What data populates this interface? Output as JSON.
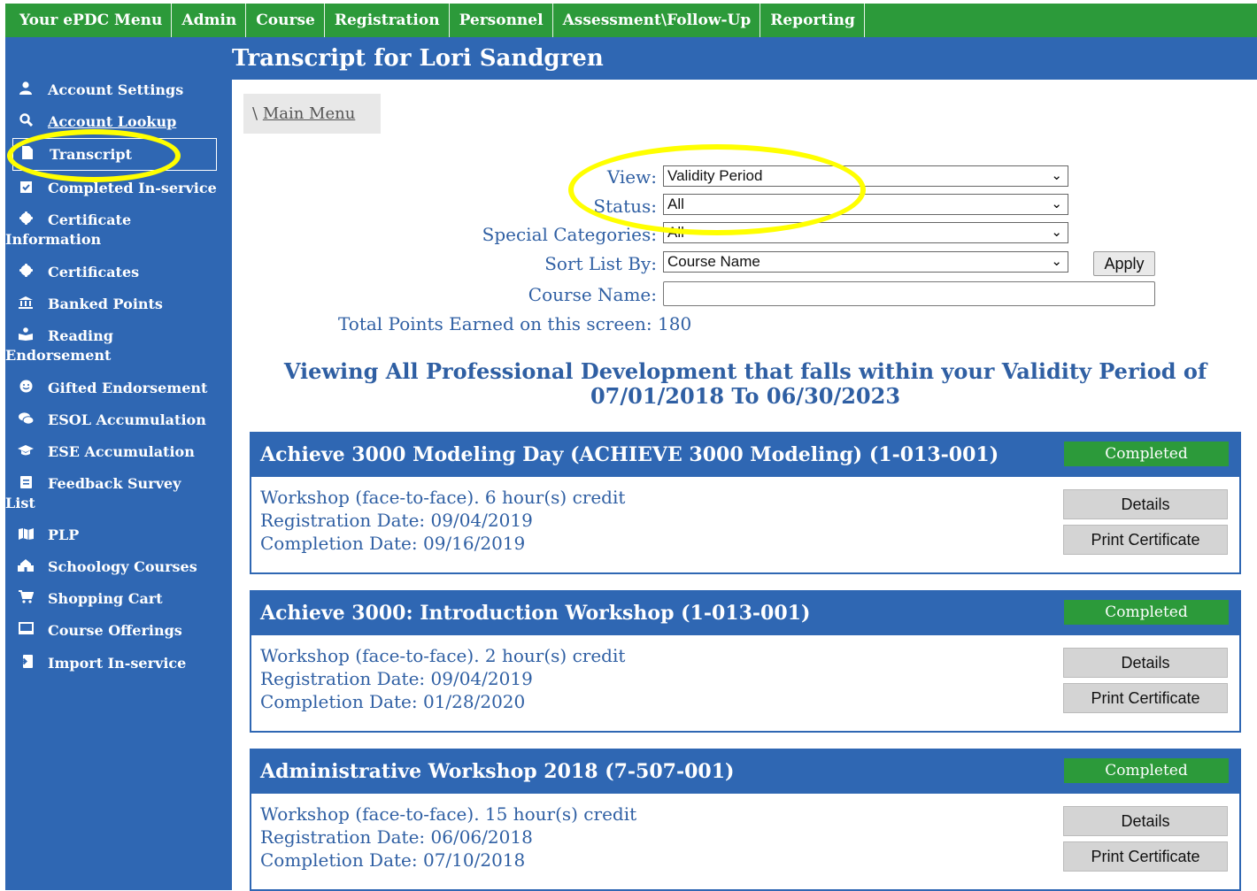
{
  "topnav": {
    "items": [
      "Your ePDC Menu",
      "Admin",
      "Course",
      "Registration",
      "Personnel",
      "Assessment\\Follow-Up",
      "Reporting"
    ]
  },
  "page": {
    "title": "Transcript for Lori Sandgren"
  },
  "sidebar": {
    "items": [
      {
        "label": "Account Settings",
        "icon": "user-icon"
      },
      {
        "label": "Account Lookup",
        "icon": "search-icon"
      },
      {
        "label": "Transcript",
        "icon": "document-icon"
      },
      {
        "label": "Completed In-service",
        "icon": "checkbox-icon"
      },
      {
        "label1": "Certificate",
        "label2": "Information",
        "icon": "certificate-icon"
      },
      {
        "label": "Certificates",
        "icon": "certificate-icon"
      },
      {
        "label": "Banked Points",
        "icon": "bank-icon"
      },
      {
        "label1": "Reading",
        "label2": "Endorsement",
        "icon": "reading-icon"
      },
      {
        "label": "Gifted Endorsement",
        "icon": "smile-icon"
      },
      {
        "label": "ESOL Accumulation",
        "icon": "chat-icon"
      },
      {
        "label": "ESE Accumulation",
        "icon": "graduation-cap-icon"
      },
      {
        "label1": "Feedback Survey",
        "label2": "List",
        "icon": "survey-icon"
      },
      {
        "label": "PLP",
        "icon": "map-icon"
      },
      {
        "label": "Schoology Courses",
        "icon": "school-icon"
      },
      {
        "label": "Shopping Cart",
        "icon": "cart-icon"
      },
      {
        "label": "Course Offerings",
        "icon": "monitor-icon"
      },
      {
        "label": "Import In-service",
        "icon": "import-icon"
      }
    ]
  },
  "breadcrumb": {
    "sep": "\\",
    "link": "Main Menu"
  },
  "filters": {
    "view_label": "View:",
    "view_value": "Validity Period",
    "status_label": "Status:",
    "status_value": "All",
    "special_label": "Special Categories:",
    "special_value": "All",
    "sort_label": "Sort List By:",
    "sort_value": "Course Name",
    "course_name_label": "Course Name:",
    "course_name_value": "",
    "apply_label": "Apply"
  },
  "total_points_text": "Total Points Earned on this screen: 180",
  "viewing_heading": {
    "line1": "Viewing All Professional Development that falls within your Validity Period of",
    "line2": "07/01/2018 To 06/30/2023"
  },
  "courses": [
    {
      "title": "Achieve 3000 Modeling Day (ACHIEVE 3000 Modeling) (1-013-001)",
      "status": "Completed",
      "type": "Workshop (face-to-face).  6 hour(s) credit",
      "registration": "Registration Date: 09/04/2019",
      "completion": "Completion Date: 09/16/2019",
      "details_label": "Details",
      "print_label": "Print Certificate"
    },
    {
      "title": "Achieve 3000: Introduction Workshop (1-013-001)",
      "status": "Completed",
      "type": "Workshop (face-to-face).  2 hour(s) credit",
      "registration": "Registration Date: 09/04/2019",
      "completion": "Completion Date: 01/28/2020",
      "details_label": "Details",
      "print_label": "Print Certificate"
    },
    {
      "title": "Administrative Workshop 2018 (7-507-001)",
      "status": "Completed",
      "type": "Workshop (face-to-face).  15 hour(s) credit",
      "registration": "Registration Date: 06/06/2018",
      "completion": "Completion Date: 07/10/2018",
      "details_label": "Details",
      "print_label": "Print Certificate"
    }
  ],
  "colors": {
    "nav_green": "#2c9a3a",
    "brand_blue": "#2f67b3",
    "text_blue": "#2f5fa3",
    "highlight": "#ffff00"
  }
}
